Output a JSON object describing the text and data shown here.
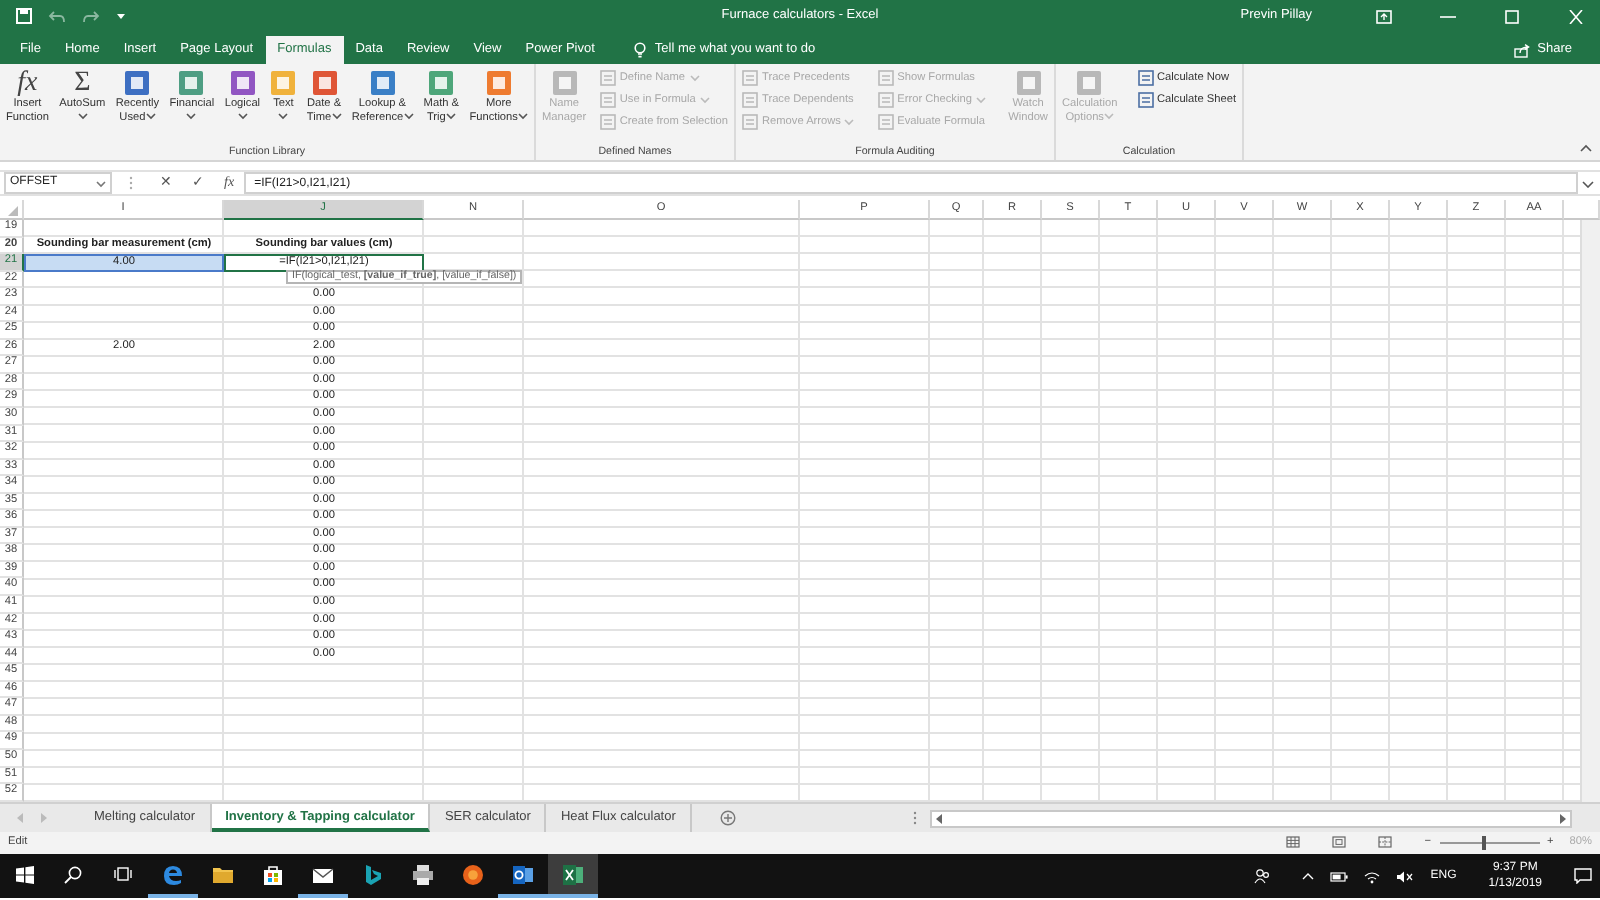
{
  "title_bar": {
    "title": "Furnace calculators - Excel",
    "user": "Previn Pillay"
  },
  "ribbon_tabs": [
    {
      "label": "File",
      "selected": false
    },
    {
      "label": "Home",
      "selected": false
    },
    {
      "label": "Insert",
      "selected": false
    },
    {
      "label": "Page Layout",
      "selected": false
    },
    {
      "label": "Formulas",
      "selected": true
    },
    {
      "label": "Data",
      "selected": false
    },
    {
      "label": "Review",
      "selected": false
    },
    {
      "label": "View",
      "selected": false
    },
    {
      "label": "Power Pivot",
      "selected": false
    }
  ],
  "tell_me": "Tell me what you want to do",
  "share": "Share",
  "ribbon_groups": [
    {
      "label": "Function Library",
      "items": [
        {
          "kind": "glyph",
          "glyph": "fx",
          "label": "Insert\nFunction",
          "dropdown": false,
          "disabled": false
        },
        {
          "kind": "glyph",
          "glyph": "Σ",
          "label": "AutoSum",
          "dropdown": true,
          "disabled": false
        },
        {
          "kind": "tile",
          "color": "#3d6fc2",
          "label": "Recently\nUsed",
          "dropdown": true,
          "disabled": false
        },
        {
          "kind": "tile",
          "color": "#4e9e83",
          "label": "Financial",
          "dropdown": true,
          "disabled": false
        },
        {
          "kind": "tile",
          "color": "#9156c2",
          "label": "Logical",
          "dropdown": true,
          "disabled": false
        },
        {
          "kind": "tile",
          "color": "#f0b23c",
          "label": "Text",
          "dropdown": true,
          "disabled": false
        },
        {
          "kind": "tile",
          "color": "#df5536",
          "label": "Date &\nTime",
          "dropdown": true,
          "disabled": false
        },
        {
          "kind": "tile",
          "color": "#3a7fc6",
          "label": "Lookup &\nReference",
          "dropdown": true,
          "disabled": false
        },
        {
          "kind": "tile",
          "color": "#4ea67a",
          "label": "Math &\nTrig",
          "dropdown": true,
          "disabled": false
        },
        {
          "kind": "tile",
          "color": "#ee7b30",
          "label": "More\nFunctions",
          "dropdown": true,
          "disabled": false
        }
      ]
    },
    {
      "label": "Defined Names",
      "items": [
        {
          "kind": "tile",
          "color": "#b8b8b8",
          "label": "Name\nManager",
          "dropdown": false,
          "disabled": true
        },
        {
          "kind": "small",
          "label": "Define Name",
          "dropdown": true,
          "disabled": true
        },
        {
          "kind": "small",
          "label": "Use in Formula",
          "dropdown": true,
          "disabled": true
        },
        {
          "kind": "small",
          "label": "Create from Selection",
          "dropdown": false,
          "disabled": true
        }
      ]
    },
    {
      "label": "Formula Auditing",
      "items": [
        {
          "kind": "small",
          "label": "Trace Precedents",
          "dropdown": false,
          "disabled": true
        },
        {
          "kind": "small",
          "label": "Trace Dependents",
          "dropdown": false,
          "disabled": true
        },
        {
          "kind": "small",
          "label": "Remove Arrows",
          "dropdown": true,
          "disabled": true
        },
        {
          "kind": "small",
          "label": "Show Formulas",
          "dropdown": false,
          "disabled": true
        },
        {
          "kind": "small",
          "label": "Error Checking",
          "dropdown": true,
          "disabled": true
        },
        {
          "kind": "small",
          "label": "Evaluate Formula",
          "dropdown": false,
          "disabled": true
        },
        {
          "kind": "tile",
          "color": "#b8b8b8",
          "label": "Watch\nWindow",
          "dropdown": false,
          "disabled": true
        }
      ]
    },
    {
      "label": "Calculation",
      "items": [
        {
          "kind": "tile",
          "color": "#b8b8b8",
          "label": "Calculation\nOptions",
          "dropdown": true,
          "disabled": true
        },
        {
          "kind": "small",
          "label": "Calculate Now",
          "dropdown": false,
          "disabled": false
        },
        {
          "kind": "small",
          "label": "Calculate Sheet",
          "dropdown": false,
          "disabled": false
        }
      ]
    }
  ],
  "formula_bar": {
    "name_box": "OFFSET",
    "cancel": "✕",
    "enter": "✓",
    "insert_function": "fx",
    "formula": "=IF(I21>0,I21,I21)"
  },
  "columns": [
    {
      "label": "I",
      "selected": false
    },
    {
      "label": "J",
      "selected": true
    },
    {
      "label": "N",
      "selected": false
    },
    {
      "label": "O",
      "selected": false
    },
    {
      "label": "P",
      "selected": false
    },
    {
      "label": "Q",
      "selected": false
    },
    {
      "label": "R",
      "selected": false
    },
    {
      "label": "S",
      "selected": false
    },
    {
      "label": "T",
      "selected": false
    },
    {
      "label": "U",
      "selected": false
    },
    {
      "label": "V",
      "selected": false
    },
    {
      "label": "W",
      "selected": false
    },
    {
      "label": "X",
      "selected": false
    },
    {
      "label": "Y",
      "selected": false
    },
    {
      "label": "Z",
      "selected": false
    },
    {
      "label": "AA",
      "selected": false
    }
  ],
  "rows": [
    {
      "number": "19",
      "selected": false,
      "kind": "value"
    },
    {
      "number": "20",
      "selected": false,
      "kind": "header",
      "i": "Sounding bar measurement (cm)",
      "j": "Sounding bar values (cm)"
    },
    {
      "number": "21",
      "selected": true,
      "kind": "value",
      "i": "4.00",
      "i_highlighted": true,
      "j": "=IF(I21>0,I21,I21)",
      "j_editing": true,
      "tooltip": "IF(logical_test, **[value_if_true]**, [value_if_false])"
    },
    {
      "number": "22",
      "selected": false,
      "kind": "value"
    },
    {
      "number": "23",
      "selected": false,
      "kind": "value",
      "j": "0.00"
    },
    {
      "number": "24",
      "selected": false,
      "kind": "value",
      "j": "0.00"
    },
    {
      "number": "25",
      "selected": false,
      "kind": "value",
      "j": "0.00"
    },
    {
      "number": "26",
      "selected": false,
      "kind": "value",
      "i": "2.00",
      "j": "2.00"
    },
    {
      "number": "27",
      "selected": false,
      "kind": "value",
      "j": "0.00"
    },
    {
      "number": "28",
      "selected": false,
      "kind": "value",
      "j": "0.00"
    },
    {
      "number": "29",
      "selected": false,
      "kind": "value",
      "j": "0.00"
    },
    {
      "number": "30",
      "selected": false,
      "kind": "value",
      "j": "0.00"
    },
    {
      "number": "31",
      "selected": false,
      "kind": "value",
      "j": "0.00"
    },
    {
      "number": "32",
      "selected": false,
      "kind": "value",
      "j": "0.00"
    },
    {
      "number": "33",
      "selected": false,
      "kind": "value",
      "j": "0.00"
    },
    {
      "number": "34",
      "selected": false,
      "kind": "value",
      "j": "0.00"
    },
    {
      "number": "35",
      "selected": false,
      "kind": "value",
      "j": "0.00"
    },
    {
      "number": "36",
      "selected": false,
      "kind": "value",
      "j": "0.00"
    },
    {
      "number": "37",
      "selected": false,
      "kind": "value",
      "j": "0.00"
    },
    {
      "number": "38",
      "selected": false,
      "kind": "value",
      "j": "0.00"
    },
    {
      "number": "39",
      "selected": false,
      "kind": "value",
      "j": "0.00"
    },
    {
      "number": "40",
      "selected": false,
      "kind": "value",
      "j": "0.00"
    },
    {
      "number": "41",
      "selected": false,
      "kind": "value",
      "j": "0.00"
    },
    {
      "number": "42",
      "selected": false,
      "kind": "value",
      "j": "0.00"
    },
    {
      "number": "43",
      "selected": false,
      "kind": "value",
      "j": "0.00"
    },
    {
      "number": "44",
      "selected": false,
      "kind": "value",
      "j": "0.00"
    },
    {
      "number": "45",
      "selected": false,
      "kind": "value"
    },
    {
      "number": "46",
      "selected": false,
      "kind": "value"
    },
    {
      "number": "47",
      "selected": false,
      "kind": "value"
    },
    {
      "number": "48",
      "selected": false,
      "kind": "value"
    },
    {
      "number": "49",
      "selected": false,
      "kind": "value"
    },
    {
      "number": "50",
      "selected": false,
      "kind": "value"
    },
    {
      "number": "51",
      "selected": false,
      "kind": "value"
    },
    {
      "number": "52",
      "selected": false,
      "kind": "value"
    }
  ],
  "sheet_tabs": [
    {
      "label": "Melting calculator",
      "selected": false
    },
    {
      "label": "Inventory & Tapping calculator",
      "selected": true
    },
    {
      "label": "SER calculator",
      "selected": false
    },
    {
      "label": "Heat Flux calculator",
      "selected": false
    }
  ],
  "status_bar": {
    "mode": "Edit",
    "zoom_out": "−",
    "zoom_in": "+",
    "level": 0.45,
    "zoom": "80%"
  },
  "taskbar_apps": [
    {
      "running": true,
      "active": false
    },
    {
      "running": false,
      "active": false
    },
    {
      "running": false,
      "active": false
    },
    {
      "running": true,
      "active": false
    },
    {
      "running": false,
      "active": false
    },
    {
      "running": false,
      "active": false
    },
    {
      "running": false,
      "active": false
    },
    {
      "running": true,
      "active": false
    },
    {
      "running": true,
      "active": true
    }
  ],
  "tray": {
    "language": "ENG",
    "time": "9:37 PM",
    "date": "1/13/2019"
  }
}
